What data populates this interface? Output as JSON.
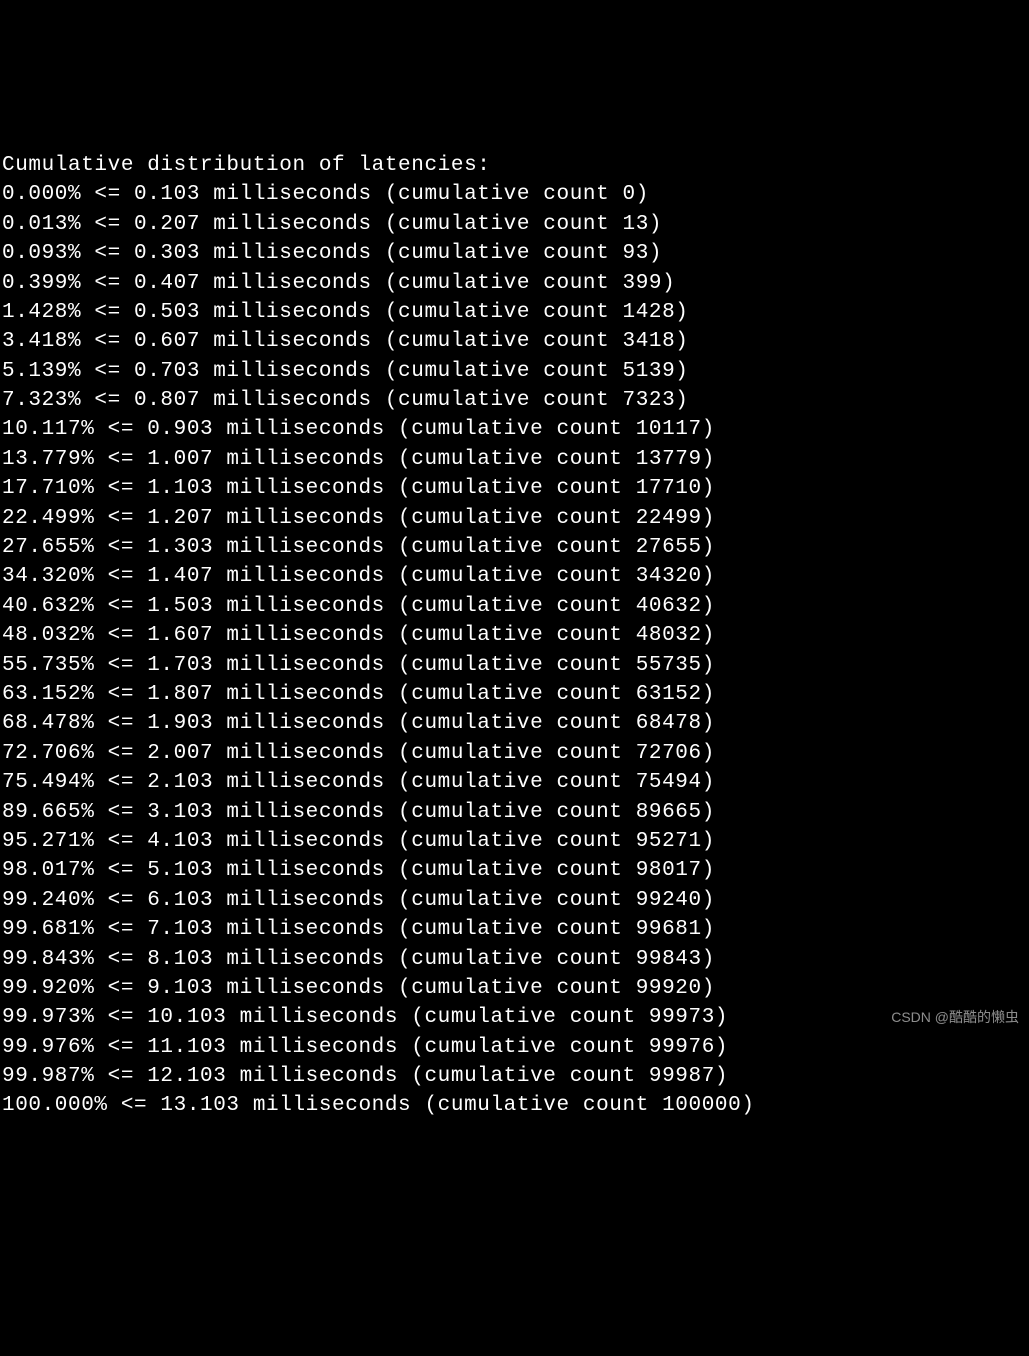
{
  "header": "Cumulative distribution of latencies:",
  "unit_label": "milliseconds",
  "cumulative_prefix": "(cumulative count ",
  "cumulative_suffix": ")",
  "op": "<=",
  "rows": [
    {
      "percent": "0.000%",
      "latency": "0.103",
      "count": "0"
    },
    {
      "percent": "0.013%",
      "latency": "0.207",
      "count": "13"
    },
    {
      "percent": "0.093%",
      "latency": "0.303",
      "count": "93"
    },
    {
      "percent": "0.399%",
      "latency": "0.407",
      "count": "399"
    },
    {
      "percent": "1.428%",
      "latency": "0.503",
      "count": "1428"
    },
    {
      "percent": "3.418%",
      "latency": "0.607",
      "count": "3418"
    },
    {
      "percent": "5.139%",
      "latency": "0.703",
      "count": "5139"
    },
    {
      "percent": "7.323%",
      "latency": "0.807",
      "count": "7323"
    },
    {
      "percent": "10.117%",
      "latency": "0.903",
      "count": "10117"
    },
    {
      "percent": "13.779%",
      "latency": "1.007",
      "count": "13779"
    },
    {
      "percent": "17.710%",
      "latency": "1.103",
      "count": "17710"
    },
    {
      "percent": "22.499%",
      "latency": "1.207",
      "count": "22499"
    },
    {
      "percent": "27.655%",
      "latency": "1.303",
      "count": "27655"
    },
    {
      "percent": "34.320%",
      "latency": "1.407",
      "count": "34320"
    },
    {
      "percent": "40.632%",
      "latency": "1.503",
      "count": "40632"
    },
    {
      "percent": "48.032%",
      "latency": "1.607",
      "count": "48032"
    },
    {
      "percent": "55.735%",
      "latency": "1.703",
      "count": "55735"
    },
    {
      "percent": "63.152%",
      "latency": "1.807",
      "count": "63152"
    },
    {
      "percent": "68.478%",
      "latency": "1.903",
      "count": "68478"
    },
    {
      "percent": "72.706%",
      "latency": "2.007",
      "count": "72706"
    },
    {
      "percent": "75.494%",
      "latency": "2.103",
      "count": "75494"
    },
    {
      "percent": "89.665%",
      "latency": "3.103",
      "count": "89665"
    },
    {
      "percent": "95.271%",
      "latency": "4.103",
      "count": "95271"
    },
    {
      "percent": "98.017%",
      "latency": "5.103",
      "count": "98017"
    },
    {
      "percent": "99.240%",
      "latency": "6.103",
      "count": "99240"
    },
    {
      "percent": "99.681%",
      "latency": "7.103",
      "count": "99681"
    },
    {
      "percent": "99.843%",
      "latency": "8.103",
      "count": "99843"
    },
    {
      "percent": "99.920%",
      "latency": "9.103",
      "count": "99920"
    },
    {
      "percent": "99.973%",
      "latency": "10.103",
      "count": "99973"
    },
    {
      "percent": "99.976%",
      "latency": "11.103",
      "count": "99976"
    },
    {
      "percent": "99.987%",
      "latency": "12.103",
      "count": "99987"
    },
    {
      "percent": "100.000%",
      "latency": "13.103",
      "count": "100000"
    }
  ],
  "watermark": "CSDN @酷酷的懒虫"
}
